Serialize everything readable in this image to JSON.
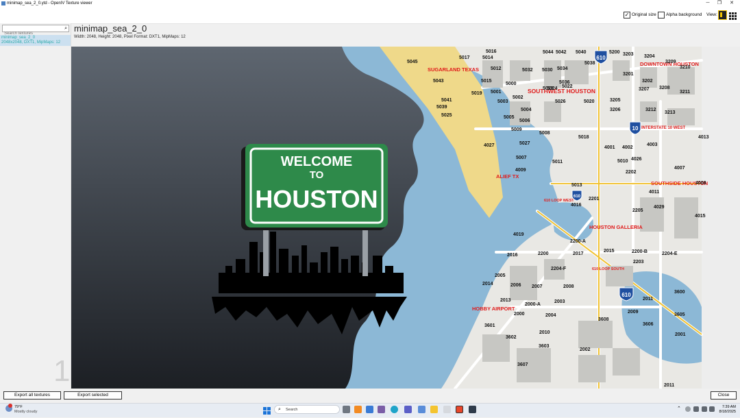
{
  "window": {
    "title": "minimap_sea_2_0.ytd - OpenIV Texture viewer",
    "minimize": "─",
    "maximize": "❐",
    "close": "✕"
  },
  "toolbar": {
    "original_size_label": "Original size",
    "original_size_checked": true,
    "alpha_background_label": "Alpha background",
    "alpha_background_checked": false,
    "view_label": "View:"
  },
  "sidebar": {
    "search_placeholder": "Search textures",
    "items": [
      {
        "name": "minimap_sea_2_0",
        "details": "2048x2048, DXT1, MipMaps: 12"
      }
    ],
    "page_number": "1"
  },
  "texture": {
    "name": "minimap_sea_2_0",
    "info": "Width: 2048, Height: 2048, Pixel Format: DXT1, MipMaps: 12"
  },
  "image": {
    "sign_line1": "WELCOME",
    "sign_line2": "TO",
    "sign_line3": "HOUSTON",
    "labels": [
      "SUGARLAND TEXAS",
      "SOUTHWEST HOUSTON",
      "DOWNTOWN HOUSTON",
      "INTERSTATE 10 WEST",
      "SOUTHSIDE HOUSTON",
      "HOUSTON GALLERIA",
      "HOBBY AIRPORT",
      "ALIEF TX",
      "610 LOOP WEST",
      "610 LOOP SOUTH"
    ],
    "highway_shields": [
      "610",
      "10",
      "610",
      "610"
    ],
    "zones": [
      "5017",
      "5016",
      "5014",
      "5012",
      "5032",
      "5030",
      "5034",
      "5038",
      "5044",
      "5042",
      "5040",
      "5200",
      "3203",
      "3204",
      "3209",
      "5045",
      "5043",
      "5015",
      "5000",
      "5036",
      "5024",
      "5022",
      "3201",
      "3202",
      "3210",
      "5041",
      "5019",
      "5001",
      "5002",
      "5028",
      "5020",
      "3205",
      "3207",
      "3208",
      "3211",
      "5039",
      "5003",
      "5004",
      "5026",
      "3206",
      "3212",
      "3213",
      "5025",
      "5005",
      "5006",
      "5008",
      "5018",
      "4001",
      "4002",
      "4003",
      "4013",
      "4027",
      "5027",
      "5009",
      "5007",
      "5011",
      "5010",
      "4026",
      "4007",
      "4009",
      "5013",
      "2202",
      "4011",
      "4008",
      "4016",
      "2201",
      "2205",
      "4029",
      "4015",
      "4019",
      "2016",
      "2200",
      "2200-A",
      "2200-B",
      "2204-E",
      "2015",
      "2017",
      "2203",
      "2204-F",
      "2014",
      "2005",
      "2006",
      "2007",
      "2008",
      "2013",
      "2000-A",
      "2003",
      "2011",
      "3600",
      "3601",
      "2000",
      "2004",
      "2009",
      "3608",
      "3606",
      "3605",
      "3602",
      "2010",
      "2001",
      "3603",
      "2002",
      "3607",
      "2011",
      "3605"
    ]
  },
  "buttons": {
    "export_all": "Export all textures",
    "export_selected": "Export selected",
    "close": "Close"
  },
  "taskbar": {
    "weather_temp": "79°F",
    "weather_desc": "Mostly cloudy",
    "search_placeholder": "Search",
    "time": "7:39 AM",
    "date": "8/18/2025"
  },
  "colors": {
    "selection": "#cce0f0",
    "item_text": "#2aa9a9",
    "sign_green": "#2e8a4a",
    "water": "#8cb8d6",
    "land": "#e9e8e4",
    "sand": "#efd98a",
    "label_red": "#e01a1a"
  }
}
